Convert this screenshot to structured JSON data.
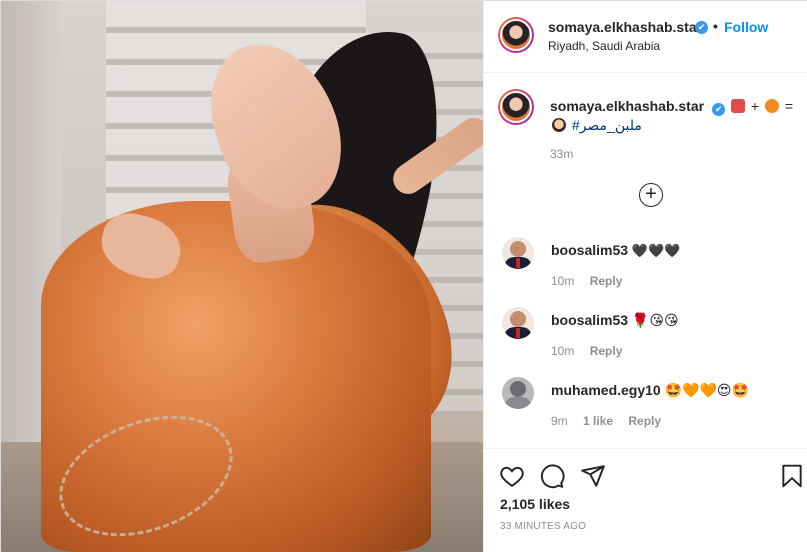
{
  "post": {
    "author": {
      "username": "somaya.elkhashab.star",
      "location": "Riyadh, Saudi Arabia",
      "follow_label": "Follow",
      "separator": "•",
      "verified_mark": "✔"
    },
    "caption": {
      "username": "somaya.elkhashab.star",
      "emoji_text": "+",
      "equals": "=",
      "hashtag": "#ملبن_مصر",
      "time": "33m"
    },
    "load_more_icon": "plus-circle-icon",
    "comments": [
      {
        "username": "boosalim53",
        "text": "🖤🖤🖤",
        "time": "10m",
        "likes": "",
        "reply_label": "Reply",
        "avatar": "man-suit-avatar"
      },
      {
        "username": "boosalim53",
        "text": "🌹😘😘",
        "time": "10m",
        "likes": "",
        "reply_label": "Reply",
        "avatar": "man-suit-avatar"
      },
      {
        "username": "muhamed.egy10",
        "text": "🤩🧡🧡😍🤩",
        "time": "9m",
        "likes": "1 like",
        "reply_label": "Reply",
        "avatar": "gray-photo-avatar"
      }
    ],
    "likes": "2,105 likes",
    "posted": "33 MINUTES AGO",
    "colors": {
      "link": "#0095f6",
      "verified": "#3897f0",
      "dress": "#d9783c"
    }
  }
}
